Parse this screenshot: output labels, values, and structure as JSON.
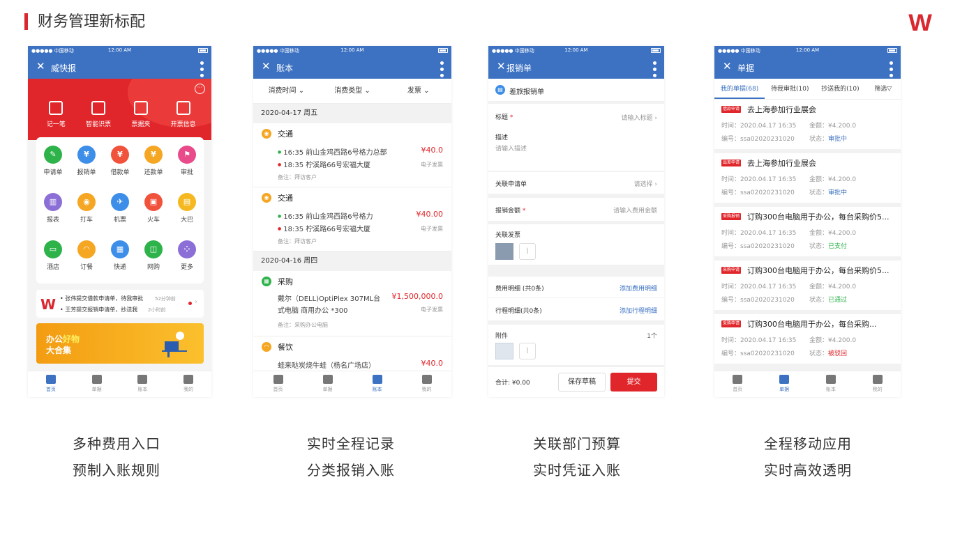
{
  "page": {
    "title": "财务管理新标配",
    "logo": "W"
  },
  "status": {
    "carrier": "●●●●● 中国移动",
    "time": "12:00 AM"
  },
  "phone1": {
    "nav_title": "威快报",
    "quick": [
      "记一笔",
      "智能识票",
      "票据夹",
      "开票信息"
    ],
    "grid": [
      {
        "label": "申请单",
        "color": "#2eb24a",
        "glyph": "✎"
      },
      {
        "label": "报销单",
        "color": "#3d8ee8",
        "glyph": "¥"
      },
      {
        "label": "借款单",
        "color": "#f0523c",
        "glyph": "¥"
      },
      {
        "label": "还款单",
        "color": "#f5a623",
        "glyph": "¥"
      },
      {
        "label": "审批",
        "color": "#e84a8a",
        "glyph": "⚑"
      },
      {
        "label": "报表",
        "color": "#8b6fd6",
        "glyph": "▥"
      },
      {
        "label": "打车",
        "color": "#f5a623",
        "glyph": "◉"
      },
      {
        "label": "机票",
        "color": "#3d8ee8",
        "glyph": "✈"
      },
      {
        "label": "火车",
        "color": "#f0523c",
        "glyph": "▣"
      },
      {
        "label": "大巴",
        "color": "#f5b820",
        "glyph": "▤"
      },
      {
        "label": "酒店",
        "color": "#2eb24a",
        "glyph": "▭"
      },
      {
        "label": "订餐",
        "color": "#f5a623",
        "glyph": "◠"
      },
      {
        "label": "快递",
        "color": "#3d8ee8",
        "glyph": "▦"
      },
      {
        "label": "网购",
        "color": "#2eb24a",
        "glyph": "◫"
      },
      {
        "label": "更多",
        "color": "#8b6fd6",
        "glyph": "⁘"
      }
    ],
    "msg": {
      "line1": "• 张伟提交借款申请单，待我审批",
      "time1": "52分钟前",
      "line2": "• 王芳提交报销申请单，抄送我",
      "time2": "2小时前"
    },
    "banner": {
      "t1a": "办公",
      "t1b": "好物",
      "t2": "大合集"
    }
  },
  "tabs": {
    "home": "首页",
    "doc": "单据",
    "book": "账本",
    "mine": "我的"
  },
  "phone2": {
    "nav_title": "账本",
    "filters": [
      "消费时间 ⌄",
      "消费类型 ⌄",
      "发票 ⌄"
    ],
    "dates": [
      "2020-04-17  周五",
      "2020-04-16  周四"
    ],
    "records": [
      {
        "title": "交通",
        "l1": "16:35  前山金鸡西路6号格力总部",
        "l2": "18:35  柠溪路66号宏福大厦",
        "amount": "¥40.0",
        "sub": "电子发票",
        "note": "备注：拜访客户"
      },
      {
        "title": "交通",
        "l1": "16:35  前山金鸡西路6号格力",
        "l2": "18:35  柠溪路66号宏福大厦",
        "amount": "¥40.00",
        "sub": "电子发票",
        "note": "备注：拜访客户"
      },
      {
        "title": "采购",
        "l1": "戴尔（DELL)OptiPlex 307ML台",
        "l2": "式电脑 商用办公 *300",
        "amount": "¥1,500,000.0",
        "sub": "电子发票",
        "note": "备注：采购办公电脑"
      },
      {
        "title": "餐饮",
        "l1": "蛙来哒炭烧牛蛙（杨名广场店）",
        "amount": "¥40.0"
      }
    ]
  },
  "phone3": {
    "nav_title": "报销单",
    "header": "差旅报销单",
    "title_label": "标题",
    "title_ph": "请输入标题",
    "desc_label": "描述",
    "desc_ph": "请输入描述",
    "link_label": "关联申请单",
    "link_ph": "请选择",
    "amount_label": "报销金额",
    "amount_ph": "请输入费用金额",
    "invoice_label": "关联发票",
    "fee_label": "费用明细 (共0条)",
    "fee_add": "添加费用明细",
    "trip_label": "行程明细(共0条)",
    "trip_add": "添加行程明细",
    "att_label": "附件",
    "att_count": "1个",
    "total": "合计: ¥0.00",
    "draft": "保存草稿",
    "submit": "提交"
  },
  "phone4": {
    "nav_title": "单据",
    "tabs": [
      "我的单据(68)",
      "待我审批(10)",
      "抄送我的(10)",
      "筛选▽"
    ],
    "cards": [
      {
        "badge": "借款申请",
        "title": "去上海参加行业展会",
        "time": "时间：2020.04.17 16:35",
        "amount": "金额：¥4.200.0",
        "no": "编号：ssa02020231020",
        "state_label": "状态：",
        "state": "审批中",
        "state_color": "#3d72c2"
      },
      {
        "badge": "出差申请",
        "title": "去上海参加行业展会",
        "time": "时间：2020.04.17 16:35",
        "amount": "金额：¥4.200.0",
        "no": "编号：ssa02020231020",
        "state_label": "状态：",
        "state": "审批中",
        "state_color": "#3d72c2"
      },
      {
        "badge": "采购报销",
        "title": "订购300台电脑用于办公，每台采购价5...",
        "time": "时间：2020.04.17 16:35",
        "amount": "金额：¥4.200.0",
        "no": "编号：ssa02020231020",
        "state_label": "状态：",
        "state": "已支付",
        "state_color": "#2eb24a"
      },
      {
        "badge": "采购申请",
        "title": "订购300台电脑用于办公，每台采购价5...",
        "time": "时间：2020.04.17 16:35",
        "amount": "金额：¥4.200.0",
        "no": "编号：ssa02020231020",
        "state_label": "状态：",
        "state": "已通过",
        "state_color": "#2eb24a"
      },
      {
        "badge": "采购申请",
        "title": "订购300台电脑用于办公，每台采购...",
        "time": "时间：2020.04.17 16:35",
        "amount": "金额：¥4.200.0",
        "no": "编号：ssa02020231020",
        "state_label": "状态：",
        "state": "被驳回",
        "state_color": "#e0262b"
      }
    ]
  },
  "captions": [
    {
      "l1": "多种费用入口",
      "l2": "预制入账规则"
    },
    {
      "l1": "实时全程记录",
      "l2": "分类报销入账"
    },
    {
      "l1": "关联部门预算",
      "l2": "实时凭证入账"
    },
    {
      "l1": "全程移动应用",
      "l2": "实时高效透明"
    }
  ]
}
